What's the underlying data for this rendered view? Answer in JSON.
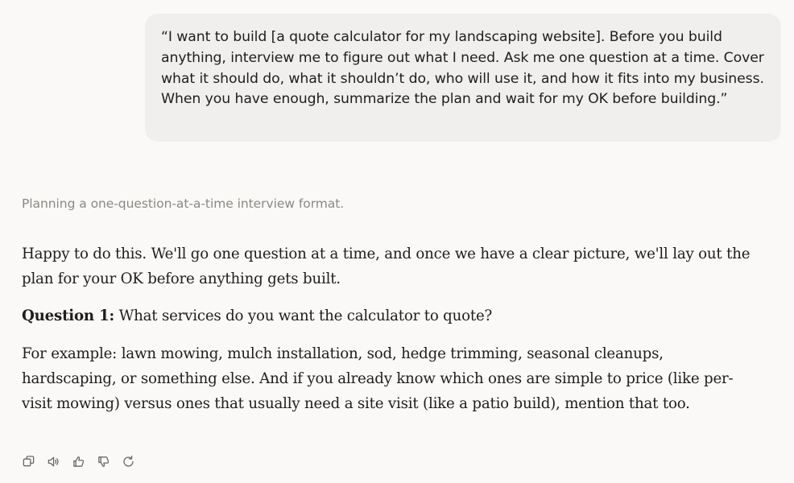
{
  "user_message": {
    "text": "“I want to build [a quote calculator for my landscaping website]. Before you build anything, interview me to figure out what I need. Ask me one question at a time. Cover what it should do, what it shouldn’t do, who will use it, and how it fits into my business. When you have enough, summarize the plan and wait for my OK before building.”"
  },
  "thinking": {
    "label": "Planning a one-question-at-a-time interview format."
  },
  "assistant_message": {
    "intro": "Happy to do this. We'll go one question at a time, and once we have a clear picture, we'll lay out the plan for your OK before anything gets built.",
    "question_label": "Question 1:",
    "question_text": " What services do you want the calculator to quote?",
    "example": "For example: lawn mowing, mulch installation, sod, hedge trimming, seasonal cleanups, hardscaping, or something else. And if you already know which ones are simple to price (like per-visit mowing) versus ones that usually need a site visit (like a patio build), mention that too."
  },
  "actions": [
    {
      "icon": "copy-icon"
    },
    {
      "icon": "speaker-icon"
    },
    {
      "icon": "thumbs-up-icon"
    },
    {
      "icon": "thumbs-down-icon"
    },
    {
      "icon": "retry-icon"
    }
  ]
}
